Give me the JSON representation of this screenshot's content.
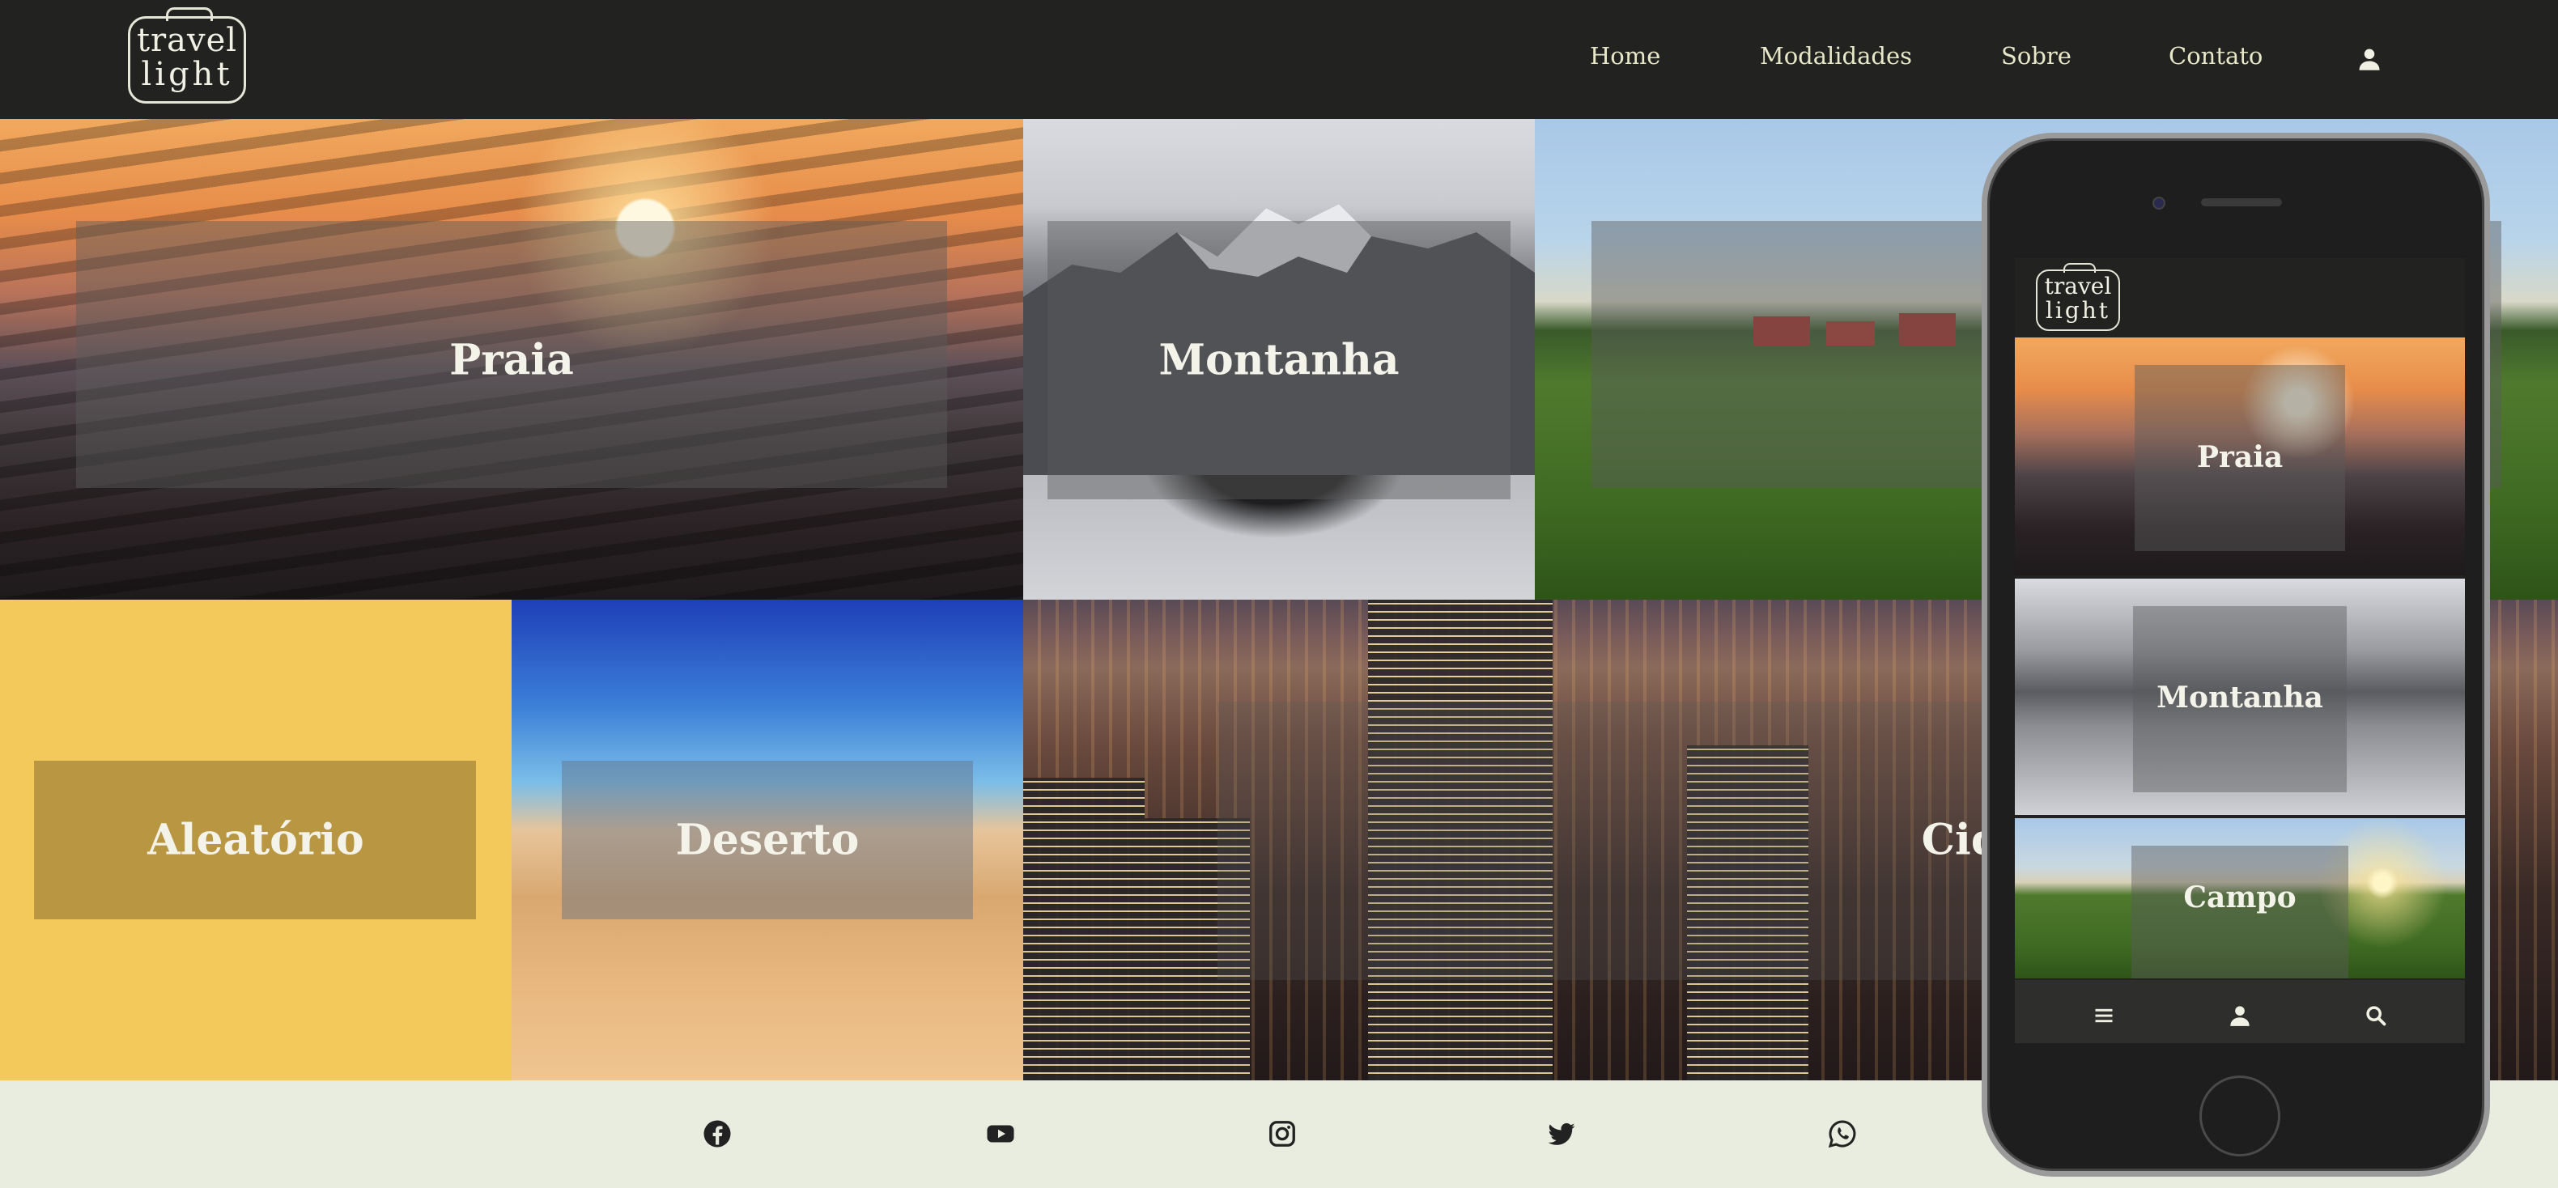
{
  "header": {
    "logo_line1": "travel",
    "logo_line2": "light",
    "nav": [
      "Home",
      "Modalidades",
      "Sobre",
      "Contato"
    ]
  },
  "tiles": {
    "praia": "Praia",
    "montanha": "Montanha",
    "campo": "Campo",
    "aleatorio": "Aleatório",
    "deserto": "Deserto",
    "cidade": "Cidade"
  },
  "footer": {
    "social": [
      "facebook-icon",
      "youtube-icon",
      "instagram-icon",
      "twitter-icon",
      "whatsapp-icon"
    ]
  },
  "mobile": {
    "logo_line1": "travel",
    "logo_line2": "light",
    "tiles": [
      "Praia",
      "Montanha",
      "Campo"
    ],
    "nav_icons": [
      "menu-icon",
      "user-icon",
      "search-icon"
    ]
  },
  "colors": {
    "header_bg": "#222220",
    "nav_text": "#e8e8c8",
    "footer_bg": "#e8ede0",
    "aleatorio_bg": "#f2c95a"
  }
}
